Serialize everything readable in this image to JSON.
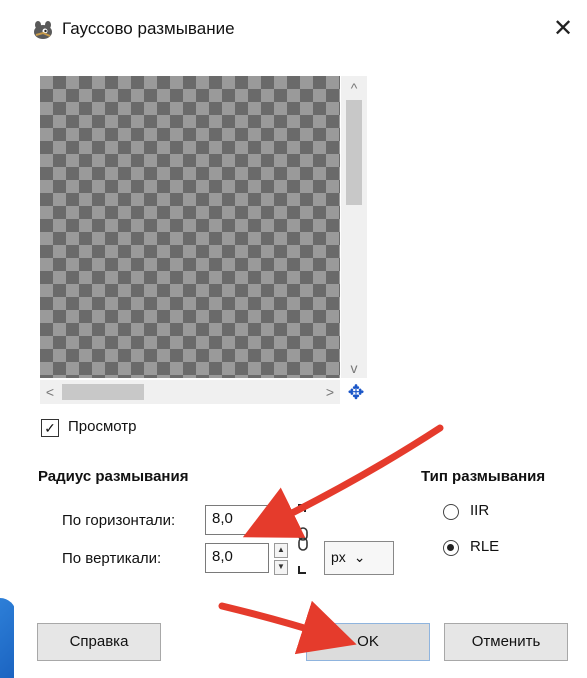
{
  "window": {
    "title": "Гауссово размывание",
    "close_glyph": "✕",
    "icon": "gimp-icon"
  },
  "preview": {
    "checkbox_checked": true,
    "checkbox_label": "Просмотр",
    "checkbox_glyph": "✓",
    "scroll_up": "^",
    "scroll_down": "v",
    "scroll_left": "<",
    "scroll_right": ">",
    "nav_glyph": "✥"
  },
  "blur_radius": {
    "title": "Радиус размывания",
    "horizontal_label": "По горизонтали:",
    "horizontal_value": "8,0",
    "vertical_label": "По вертикали:",
    "vertical_value": "8,0",
    "unit": "px",
    "unit_caret": "⌄",
    "spin_up": "▲",
    "spin_down": "▼"
  },
  "blur_type": {
    "title": "Тип размывания",
    "options": [
      {
        "label": "IIR",
        "selected": false
      },
      {
        "label": "RLE",
        "selected": true
      }
    ]
  },
  "buttons": {
    "help": "Справка",
    "ok": "OK",
    "cancel": "Отменить"
  },
  "colors": {
    "annotation_arrow": "#e53b2c",
    "accent_blue": "#1b63c0"
  }
}
